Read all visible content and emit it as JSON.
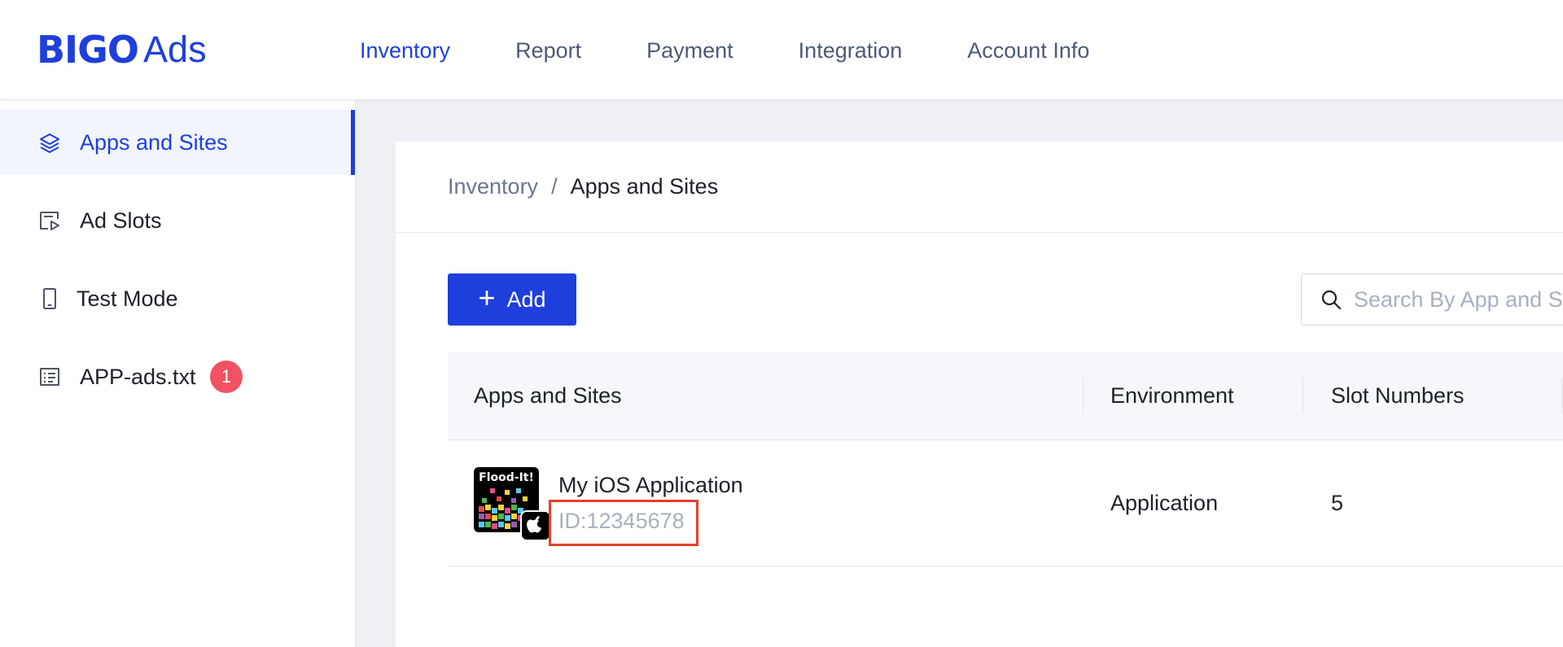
{
  "header": {
    "logo": {
      "brand": "BIGO",
      "product": "Ads"
    },
    "nav": [
      {
        "label": "Inventory",
        "active": true
      },
      {
        "label": "Report",
        "active": false
      },
      {
        "label": "Payment",
        "active": false
      },
      {
        "label": "Integration",
        "active": false
      },
      {
        "label": "Account Info",
        "active": false
      }
    ]
  },
  "sidebar": {
    "items": [
      {
        "label": "Apps and Sites",
        "icon": "layers-icon",
        "active": true
      },
      {
        "label": "Ad Slots",
        "icon": "ad-slot-icon",
        "active": false
      },
      {
        "label": "Test Mode",
        "icon": "phone-icon",
        "active": false
      },
      {
        "label": "APP-ads.txt",
        "icon": "text-file-icon",
        "active": false,
        "badge": "1"
      }
    ]
  },
  "main": {
    "breadcrumb": {
      "parent": "Inventory",
      "separator": "/",
      "current": "Apps and Sites"
    },
    "add_button": {
      "label": "Add"
    },
    "search": {
      "placeholder": "Search By App and Site Name"
    },
    "table": {
      "columns": [
        "Apps and Sites",
        "Environment",
        "Slot Numbers"
      ],
      "rows": [
        {
          "app_icon_title": "Flood-It!",
          "name": "My iOS Application",
          "id": "ID:12345678",
          "environment": "Application",
          "slot_numbers": "5",
          "platform": "apple-icon"
        }
      ]
    }
  },
  "colors": {
    "accent": "#1e3fdb",
    "badge": "#f25261",
    "highlight": "#e5402a",
    "muted_text": "#a8b0c0"
  }
}
